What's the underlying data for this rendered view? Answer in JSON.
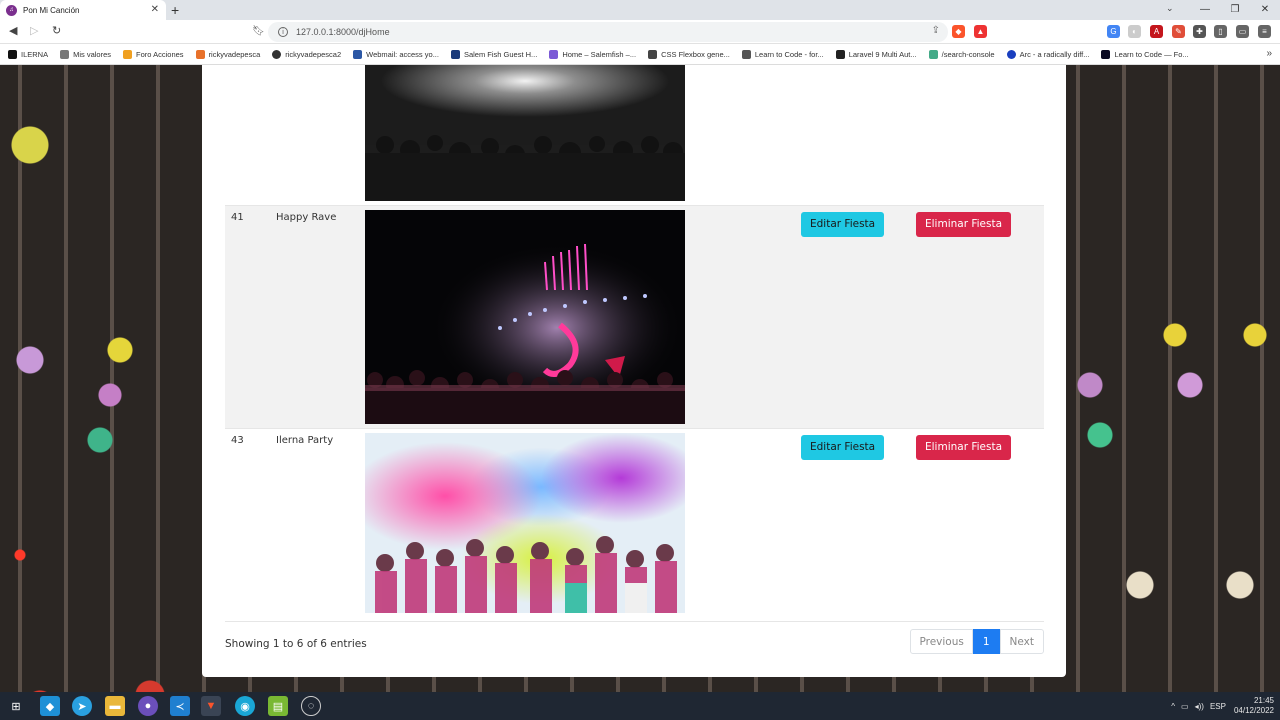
{
  "browser": {
    "tab_title": "Pon Mi Canción",
    "address": "127.0.0.1:8000/djHome",
    "bookmarks": [
      "ILERNA",
      "Mis valores",
      "Foro Acciones",
      "rickyvadepesca",
      "rickyvadepesca2",
      "Webmail: access yo...",
      "Salem Fish Guest H...",
      "Home – Salemfish –...",
      "CSS Flexbox gene...",
      "Learn to Code - for...",
      "Laravel 9 Multi Aut...",
      "/search-console",
      "Arc - a radically diff...",
      "Learn to Code — Fo..."
    ]
  },
  "table": {
    "rows": [
      {
        "id": "",
        "name": "",
        "image": "concert-crowd-bw",
        "edit_label": "",
        "delete_label": ""
      },
      {
        "id": "41",
        "name": "Happy Rave",
        "image": "rave-lights",
        "edit_label": "Editar Fiesta",
        "delete_label": "Eliminar Fiesta"
      },
      {
        "id": "43",
        "name": "Ilerna Party",
        "image": "holi-color-party",
        "edit_label": "Editar Fiesta",
        "delete_label": "Eliminar Fiesta"
      }
    ],
    "info": "Showing 1 to 6 of 6 entries",
    "pagination": {
      "previous": "Previous",
      "current": "1",
      "next": "Next"
    }
  },
  "taskbar": {
    "lang": "ESP",
    "time": "21:45",
    "date": "04/12/2022"
  },
  "colors": {
    "edit_button": "#1fc8e3",
    "delete_button": "#d9264a",
    "page_active": "#1d7cf2"
  }
}
